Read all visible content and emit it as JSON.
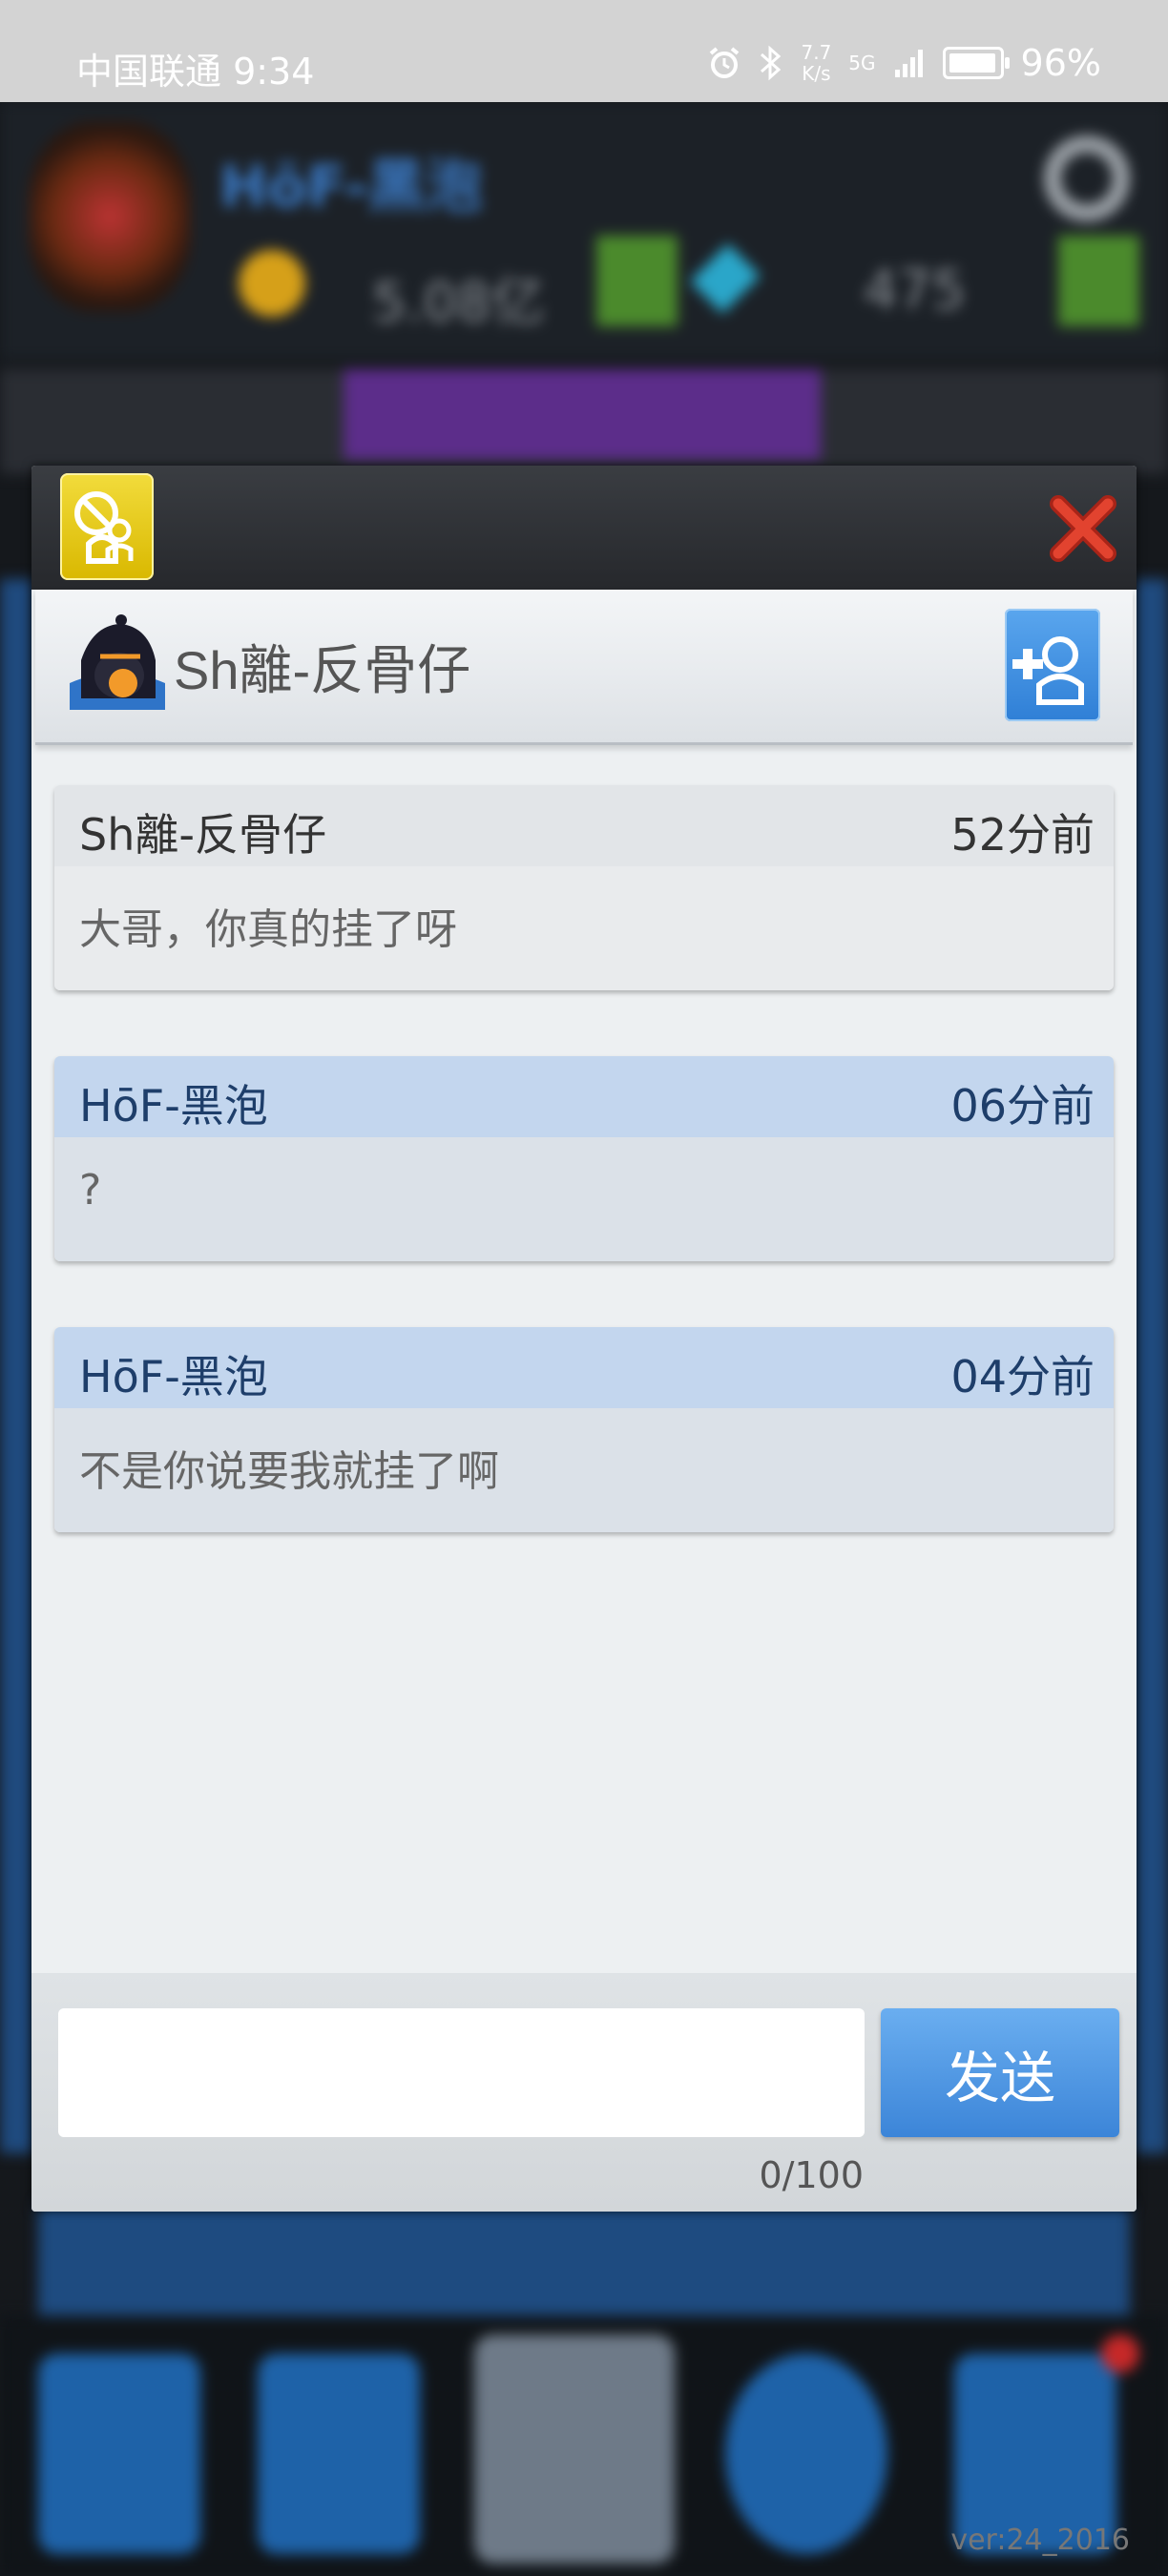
{
  "status_bar": {
    "carrier_time": "中国联通 9:34",
    "net_speed_value": "7.7",
    "net_speed_unit": "K/s",
    "network_type": "5G",
    "battery_percent_text": "96%",
    "battery_level": 0.96
  },
  "background": {
    "player_name": "HōF-黑泡",
    "coin_value": "5.08亿",
    "gem_value": "475",
    "version": "ver:24_2016"
  },
  "chat": {
    "partner_name": "Sh離-反骨仔",
    "messages": [
      {
        "sender": "Sh離-反骨仔",
        "time": "52分前",
        "text": "大哥，你真的挂了呀",
        "is_self": false
      },
      {
        "sender": "HōF-黑泡",
        "time": "06分前",
        "text": "?",
        "is_self": true
      },
      {
        "sender": "HōF-黑泡",
        "time": "04分前",
        "text": "不是你说要我就挂了啊",
        "is_self": true
      }
    ],
    "input_value": "",
    "send_label": "发送",
    "char_count": "0/100"
  },
  "colors": {
    "block_button": "#e6c619",
    "add_friend_button": "#3f8ee0",
    "close_icon": "#d33a2a",
    "self_message_header": "#c3d6ee"
  },
  "icons": {
    "block": "block-user-icon",
    "close": "close-icon",
    "add_friend": "add-friend-icon",
    "avatar": "ninja-avatar-icon"
  }
}
